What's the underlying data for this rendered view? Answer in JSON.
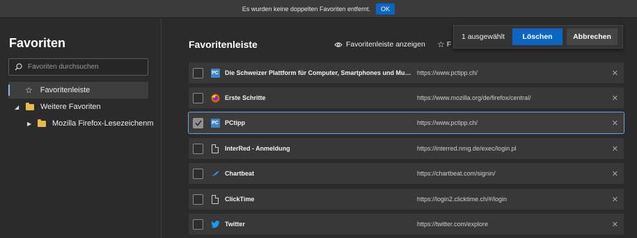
{
  "notification": {
    "text": "Es wurden keine doppelten Favoriten entfernt.",
    "ok_label": "OK"
  },
  "sidebar": {
    "title": "Favoriten",
    "search_placeholder": "Favoriten durchsuchen",
    "items": [
      {
        "label": "Favoritenleiste"
      },
      {
        "label": "Weitere Favoriten"
      },
      {
        "label": "Mozilla Firefox-Lesezeichenm"
      }
    ]
  },
  "main": {
    "title": "Favoritenleiste",
    "show_bar_label": "Favoritenleiste anzeigen",
    "star_label": "F",
    "selection": {
      "count_text": "1 ausgewählt",
      "delete_label": "Löschen",
      "cancel_label": "Abbrechen"
    },
    "rows": [
      {
        "name": "Die Schweizer Plattform für Computer, Smartphones und Multi...",
        "url": "https://www.pctipp.ch/",
        "icon": "pctipp-icon",
        "checked": false
      },
      {
        "name": "Erste Schritte",
        "url": "https://www.mozilla.org/de/firefox/central/",
        "icon": "firefox-icon",
        "checked": false
      },
      {
        "name": "PCtipp",
        "url": "https://www.pctipp.ch/",
        "icon": "pctipp-icon",
        "checked": true
      },
      {
        "name": "InterRed - Anmeldung",
        "url": "https://interred.nmg.de/exec/login.pl",
        "icon": "page-icon",
        "checked": false
      },
      {
        "name": "Chartbeat",
        "url": "https://chartbeat.com/signin/",
        "icon": "chartbeat-icon",
        "checked": false
      },
      {
        "name": "ClickTime",
        "url": "https://login2.clicktime.ch/#/login",
        "icon": "page-icon",
        "checked": false
      },
      {
        "name": "Twitter",
        "url": "https://twitter.com/explore",
        "icon": "twitter-icon",
        "checked": false
      }
    ]
  },
  "colors": {
    "accent": "#0a66c2",
    "background": "#2b2b2b",
    "row": "#383838",
    "selection_outline": "#6aa4e0",
    "folder": "#e9b949"
  }
}
